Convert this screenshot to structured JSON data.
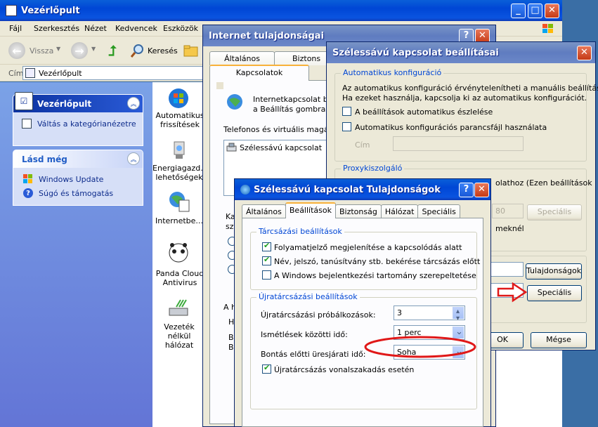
{
  "cp": {
    "title": "Vezérlőpult",
    "menu": [
      "Fájl",
      "Szerkesztés",
      "Nézet",
      "Kedvencek",
      "Eszközök"
    ],
    "toolbar": {
      "back": "Vissza",
      "search": "Keresés"
    },
    "address": {
      "label": "Cím",
      "value": "Vezérlőpult"
    },
    "panel1": {
      "title": "Vezérlőpult",
      "link": "Váltás a kategórianézetre"
    },
    "panel2": {
      "title": "Lásd még",
      "links": [
        "Windows Update",
        "Súgó és támogatás"
      ]
    },
    "icons": [
      {
        "label": "Automatikus frissítések"
      },
      {
        "label": "Energiagazd... lehetőségek"
      },
      {
        "label": "Internetbe..."
      },
      {
        "label": "Panda Cloud Antivirus"
      },
      {
        "label": "Vezeték nélkül hálózat"
      }
    ]
  },
  "ie": {
    "title": "Internet tulajdonságai",
    "tabs": [
      "Általános",
      "Biztons"
    ],
    "active_tab": "Kapcsolatok",
    "text1": "Internetkapcsolat beá",
    "text2": "a Beállítás gombra.",
    "dialup_label": "Telefonos és virtuális magánhá",
    "list_item": "Szélessávú kapcsolat",
    "frag1": "Kat",
    "frag2": "sze",
    "frag3": "A he",
    "frag4": "H",
    "frag5": "B",
    "frag6": "B"
  },
  "bb": {
    "title": "Szélessávú kapcsolat beállításai",
    "auto_group": "Automatikus konfiguráció",
    "auto_text1": "Az automatikus konfiguráció érvénytelenítheti a manuális beállításokat.",
    "auto_text2": "Ha ezeket használja, kapcsolja ki az automatikus konfigurációt.",
    "cb_detect": "A beállítások automatikus észlelése",
    "cb_script": "Automatikus konfigurációs parancsfájl használata",
    "addr_label": "Cím",
    "proxy_group": "Proxykiszolgáló",
    "proxy_text": "olathoz (Ezen beállítások",
    "port_frag": "80",
    "advanced": "Speciális",
    "bypass_frag": "meknél",
    "properties": "Tulajdonságok",
    "ok": "OK",
    "cancel": "Mégse"
  },
  "props": {
    "title": "Szélessávú kapcsolat Tulajdonságok",
    "tabs": [
      "Általános",
      "Beállítások",
      "Biztonság",
      "Hálózat",
      "Speciális"
    ],
    "dial_group": "Tárcsázási beállítások",
    "cb1": "Folyamatjelző megjelenítése a kapcsolódás alatt",
    "cb2": "Név, jelszó, tanúsítvány stb. bekérése tárcsázás előtt",
    "cb3": "A Windows bejelentkezési tartomány szerepeltetése",
    "redial_group": "Újratárcsázási beállítások",
    "attempts_label": "Újratárcsázási próbálkozások:",
    "attempts_value": "3",
    "interval_label": "Ismétlések közötti idő:",
    "interval_value": "1 perc",
    "idle_label": "Bontás előtti üresjárati idő:",
    "idle_value": "Soha",
    "cb4": "Újratárcsázás vonalszakadás esetén"
  }
}
